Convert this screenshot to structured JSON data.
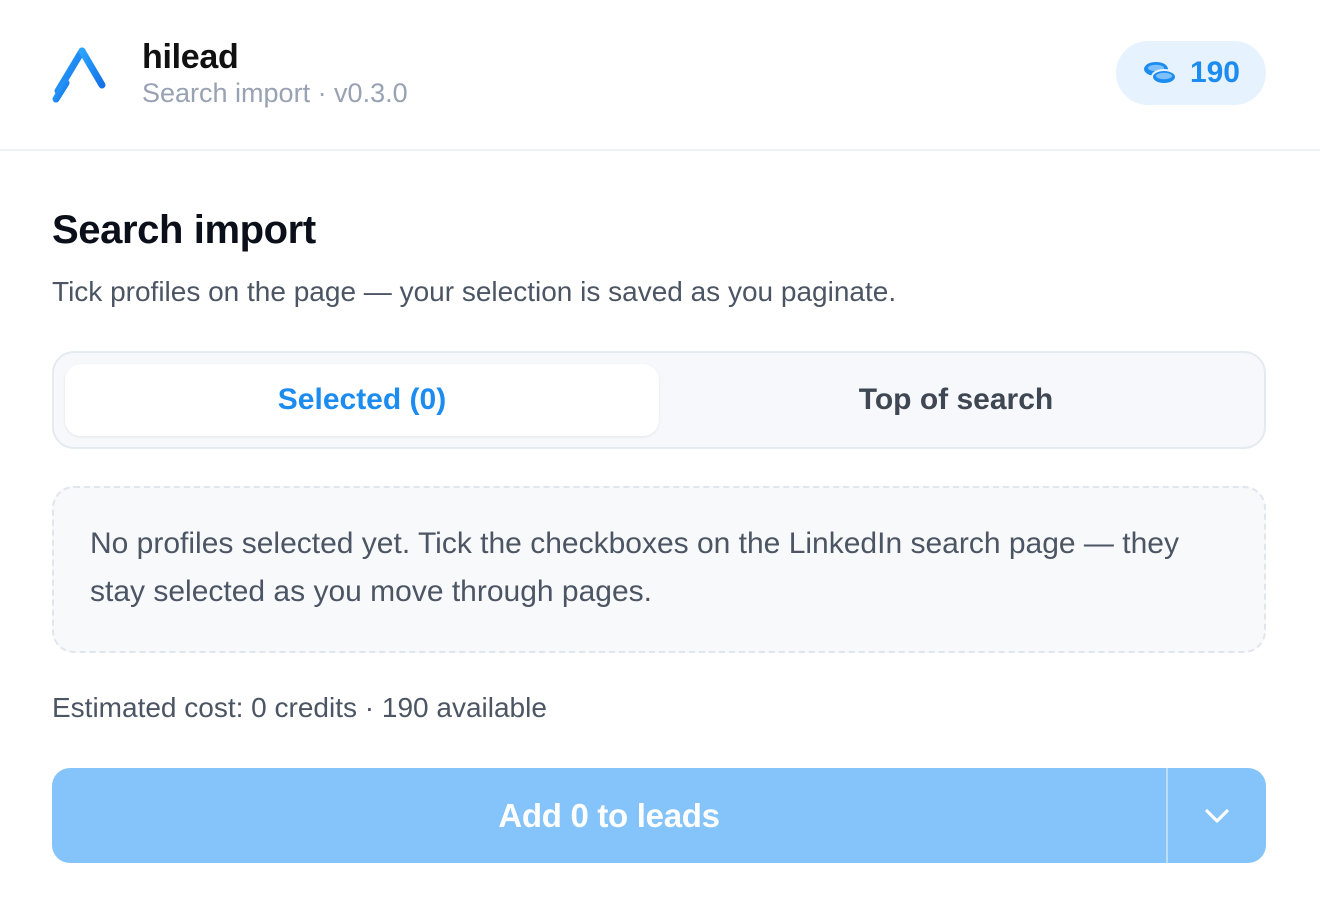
{
  "header": {
    "app_name": "hilead",
    "subtitle": "Search import · v0.3.0",
    "credits_icon": "coins-icon",
    "credits": "190",
    "brand_color": "#1d8cf0"
  },
  "main": {
    "title": "Search import",
    "description": "Tick profiles on the page — your selection is saved as you paginate.",
    "tabs": [
      {
        "label": "Selected (0)",
        "active": true
      },
      {
        "label": "Top of search",
        "active": false
      }
    ],
    "empty_state": "No profiles selected yet. Tick the checkboxes on the LinkedIn search page — they stay selected as you move through pages.",
    "cost_summary": "Estimated cost: 0 credits · 190 available"
  },
  "actions": {
    "primary_label": "Add 0 to leads",
    "primary_disabled": true,
    "dropdown_icon": "chevron-down-icon",
    "button_color": "#84c4fa"
  }
}
